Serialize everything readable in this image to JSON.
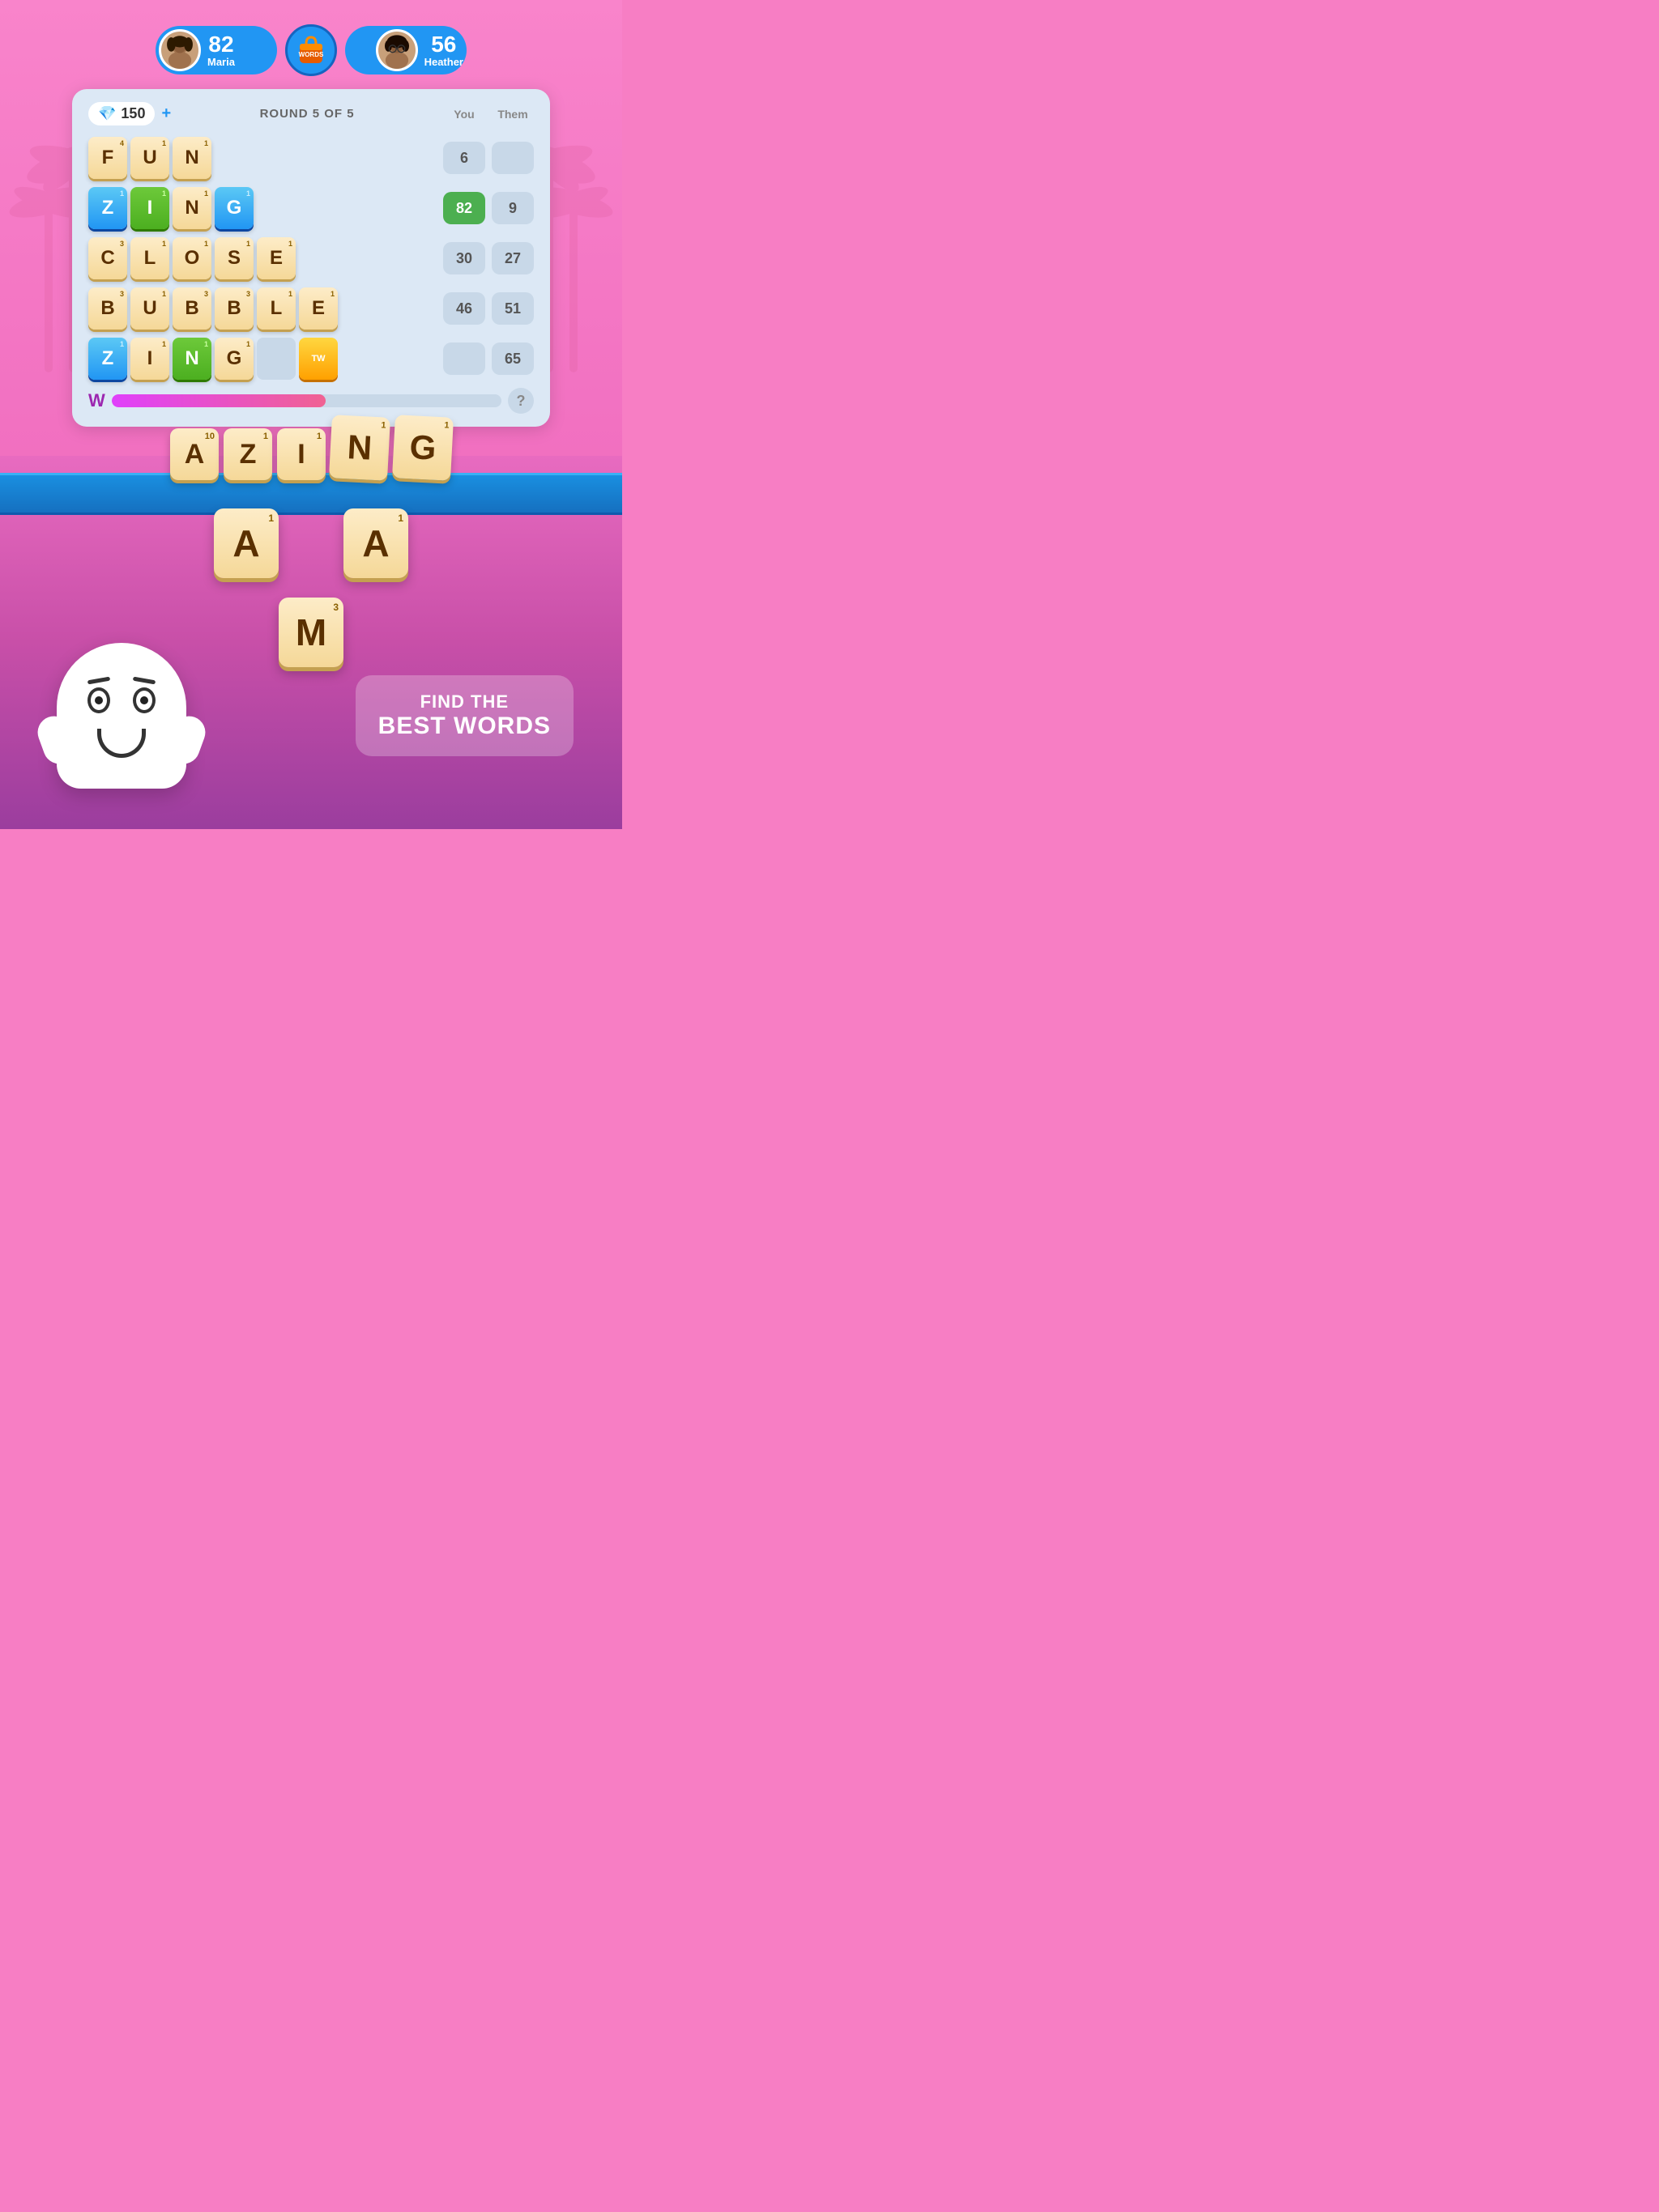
{
  "players": {
    "left": {
      "name": "Maria",
      "score": "82",
      "avatar_color": "#8B4513"
    },
    "right": {
      "name": "Heather",
      "score": "56",
      "avatar_color": "#654321"
    }
  },
  "board": {
    "gem_count": "150",
    "round_text": "ROUND 5 OF 5",
    "col_you": "You",
    "col_them": "Them",
    "add_label": "+",
    "help_label": "?"
  },
  "words": [
    {
      "letters": [
        {
          "char": "F",
          "pts": "4"
        },
        {
          "char": "U",
          "pts": "1"
        },
        {
          "char": "N",
          "pts": "1"
        }
      ],
      "score_you": "6",
      "score_them": ""
    },
    {
      "letters": [
        {
          "char": "Z",
          "pts": "1",
          "style": "blue"
        },
        {
          "char": "I",
          "pts": "1",
          "style": "green"
        },
        {
          "char": "N",
          "pts": "1"
        },
        {
          "char": "G",
          "pts": "1",
          "style": "blue"
        }
      ],
      "score_you": "82",
      "score_them": "9",
      "you_green": true
    },
    {
      "letters": [
        {
          "char": "C",
          "pts": "3"
        },
        {
          "char": "L",
          "pts": "1"
        },
        {
          "char": "O",
          "pts": "1"
        },
        {
          "char": "S",
          "pts": "1"
        },
        {
          "char": "E",
          "pts": "1"
        }
      ],
      "score_you": "30",
      "score_them": "27"
    },
    {
      "letters": [
        {
          "char": "B",
          "pts": "3"
        },
        {
          "char": "U",
          "pts": "1"
        },
        {
          "char": "B",
          "pts": "3"
        },
        {
          "char": "B",
          "pts": "3"
        },
        {
          "char": "L",
          "pts": "1"
        },
        {
          "char": "E",
          "pts": "1"
        }
      ],
      "score_you": "46",
      "score_them": "51"
    },
    {
      "letters": [
        {
          "char": "Z",
          "pts": "1",
          "style": "blue"
        },
        {
          "char": "I",
          "pts": "1"
        },
        {
          "char": "N",
          "pts": "1",
          "style": "green"
        },
        {
          "char": "G",
          "pts": "1"
        },
        {
          "char": "",
          "pts": "",
          "style": "empty"
        },
        {
          "char": "TW",
          "pts": "",
          "style": "tw"
        }
      ],
      "score_you": "",
      "score_them": "65"
    }
  ],
  "floating_word": {
    "letters": [
      {
        "char": "A",
        "pts": "10"
      },
      {
        "char": "Z",
        "pts": "1"
      },
      {
        "char": "I",
        "pts": "1"
      },
      {
        "char": "N",
        "pts": "1"
      },
      {
        "char": "G",
        "pts": "1"
      }
    ]
  },
  "bottom_tiles": [
    {
      "char": "A",
      "pts": "1"
    },
    {
      "char": "A",
      "pts": "1"
    }
  ],
  "bottom_tile_m": {
    "char": "M",
    "pts": "3"
  },
  "speech": {
    "line1": "FIND THE",
    "line2": "BEST WORDS"
  },
  "timer": {
    "w_label": "W"
  }
}
